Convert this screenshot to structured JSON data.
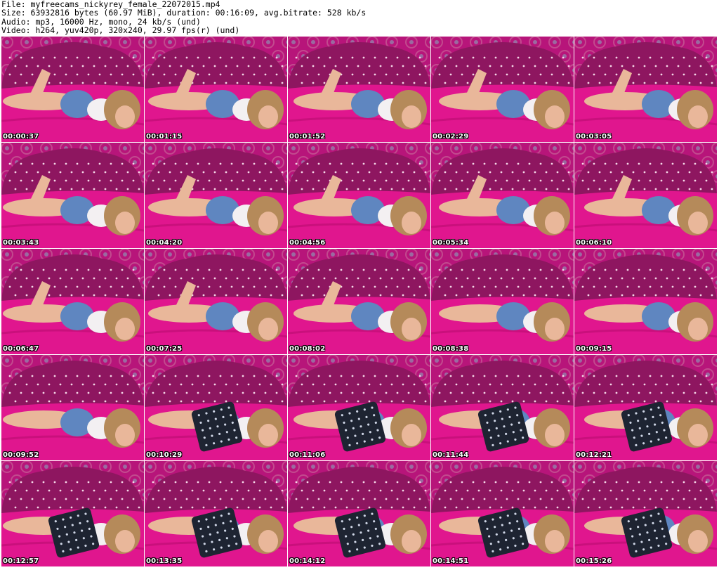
{
  "header": {
    "line1": "File: myfreecams_nickyrey_female_22072015.mp4",
    "line2": "Size: 63932816 bytes (60.97 MiB), duration: 00:16:09, avg.bitrate: 528 kb/s",
    "line3": "Audio: mp3, 16000 Hz, mono, 24 kb/s (und)",
    "line4": "Video: h264, yuv420p, 320x240, 29.97 fps(r) (und)"
  },
  "thumbnails": [
    {
      "timestamp": "00:00:37",
      "pillow": false
    },
    {
      "timestamp": "00:01:15",
      "pillow": false
    },
    {
      "timestamp": "00:01:52",
      "pillow": false
    },
    {
      "timestamp": "00:02:29",
      "pillow": false
    },
    {
      "timestamp": "00:03:05",
      "pillow": false
    },
    {
      "timestamp": "00:03:43",
      "pillow": false
    },
    {
      "timestamp": "00:04:20",
      "pillow": false
    },
    {
      "timestamp": "00:04:56",
      "pillow": false
    },
    {
      "timestamp": "00:05:34",
      "pillow": false
    },
    {
      "timestamp": "00:06:10",
      "pillow": false
    },
    {
      "timestamp": "00:06:47",
      "pillow": false
    },
    {
      "timestamp": "00:07:25",
      "pillow": false
    },
    {
      "timestamp": "00:08:02",
      "pillow": false
    },
    {
      "timestamp": "00:08:38",
      "pillow": false
    },
    {
      "timestamp": "00:09:15",
      "pillow": false
    },
    {
      "timestamp": "00:09:52",
      "pillow": false
    },
    {
      "timestamp": "00:10:29",
      "pillow": true
    },
    {
      "timestamp": "00:11:06",
      "pillow": true
    },
    {
      "timestamp": "00:11:44",
      "pillow": true
    },
    {
      "timestamp": "00:12:21",
      "pillow": true
    },
    {
      "timestamp": "00:12:57",
      "pillow": true
    },
    {
      "timestamp": "00:13:35",
      "pillow": true
    },
    {
      "timestamp": "00:14:12",
      "pillow": true
    },
    {
      "timestamp": "00:14:51",
      "pillow": true
    },
    {
      "timestamp": "00:15:26",
      "pillow": true
    }
  ],
  "colors": {
    "wall": "#b7157a",
    "headboard": "#8e1660",
    "sheet": "#e0168e",
    "skin": "#e9b79a",
    "shorts": "#5f86c0",
    "hair": "#b58a5a",
    "pillow": "#1e2432"
  }
}
